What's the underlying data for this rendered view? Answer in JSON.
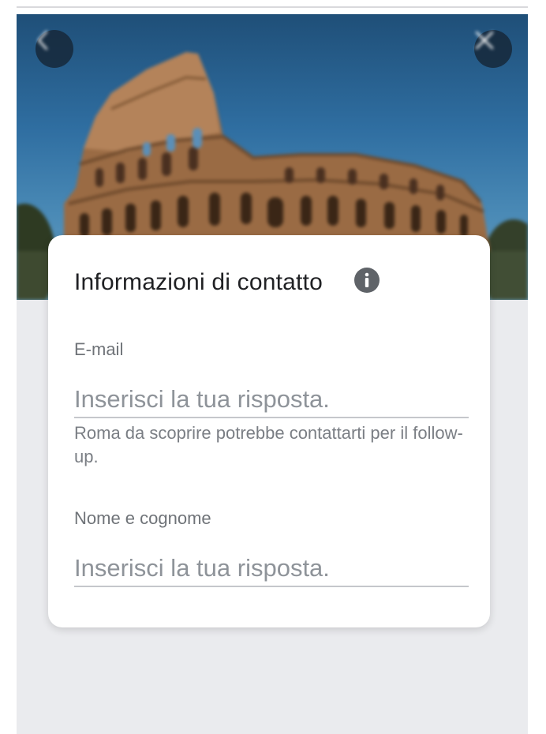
{
  "card": {
    "title": "Informazioni di contatto"
  },
  "fields": {
    "email": {
      "label": "E-mail",
      "placeholder": "Inserisci la tua risposta.",
      "value": "",
      "helper": "Roma da scoprire potrebbe contattarti per il follow-up."
    },
    "name": {
      "label": "Nome e cognome",
      "placeholder": "Inserisci la tua risposta.",
      "value": ""
    }
  },
  "icons": {
    "back": "chevron-left-icon",
    "close": "close-icon",
    "info": "info-icon"
  },
  "colors": {
    "page_background": "#eaebee",
    "card_background": "#ffffff",
    "title_text": "#202124",
    "muted_text": "#6f7378",
    "hero_button": "#16283a"
  }
}
